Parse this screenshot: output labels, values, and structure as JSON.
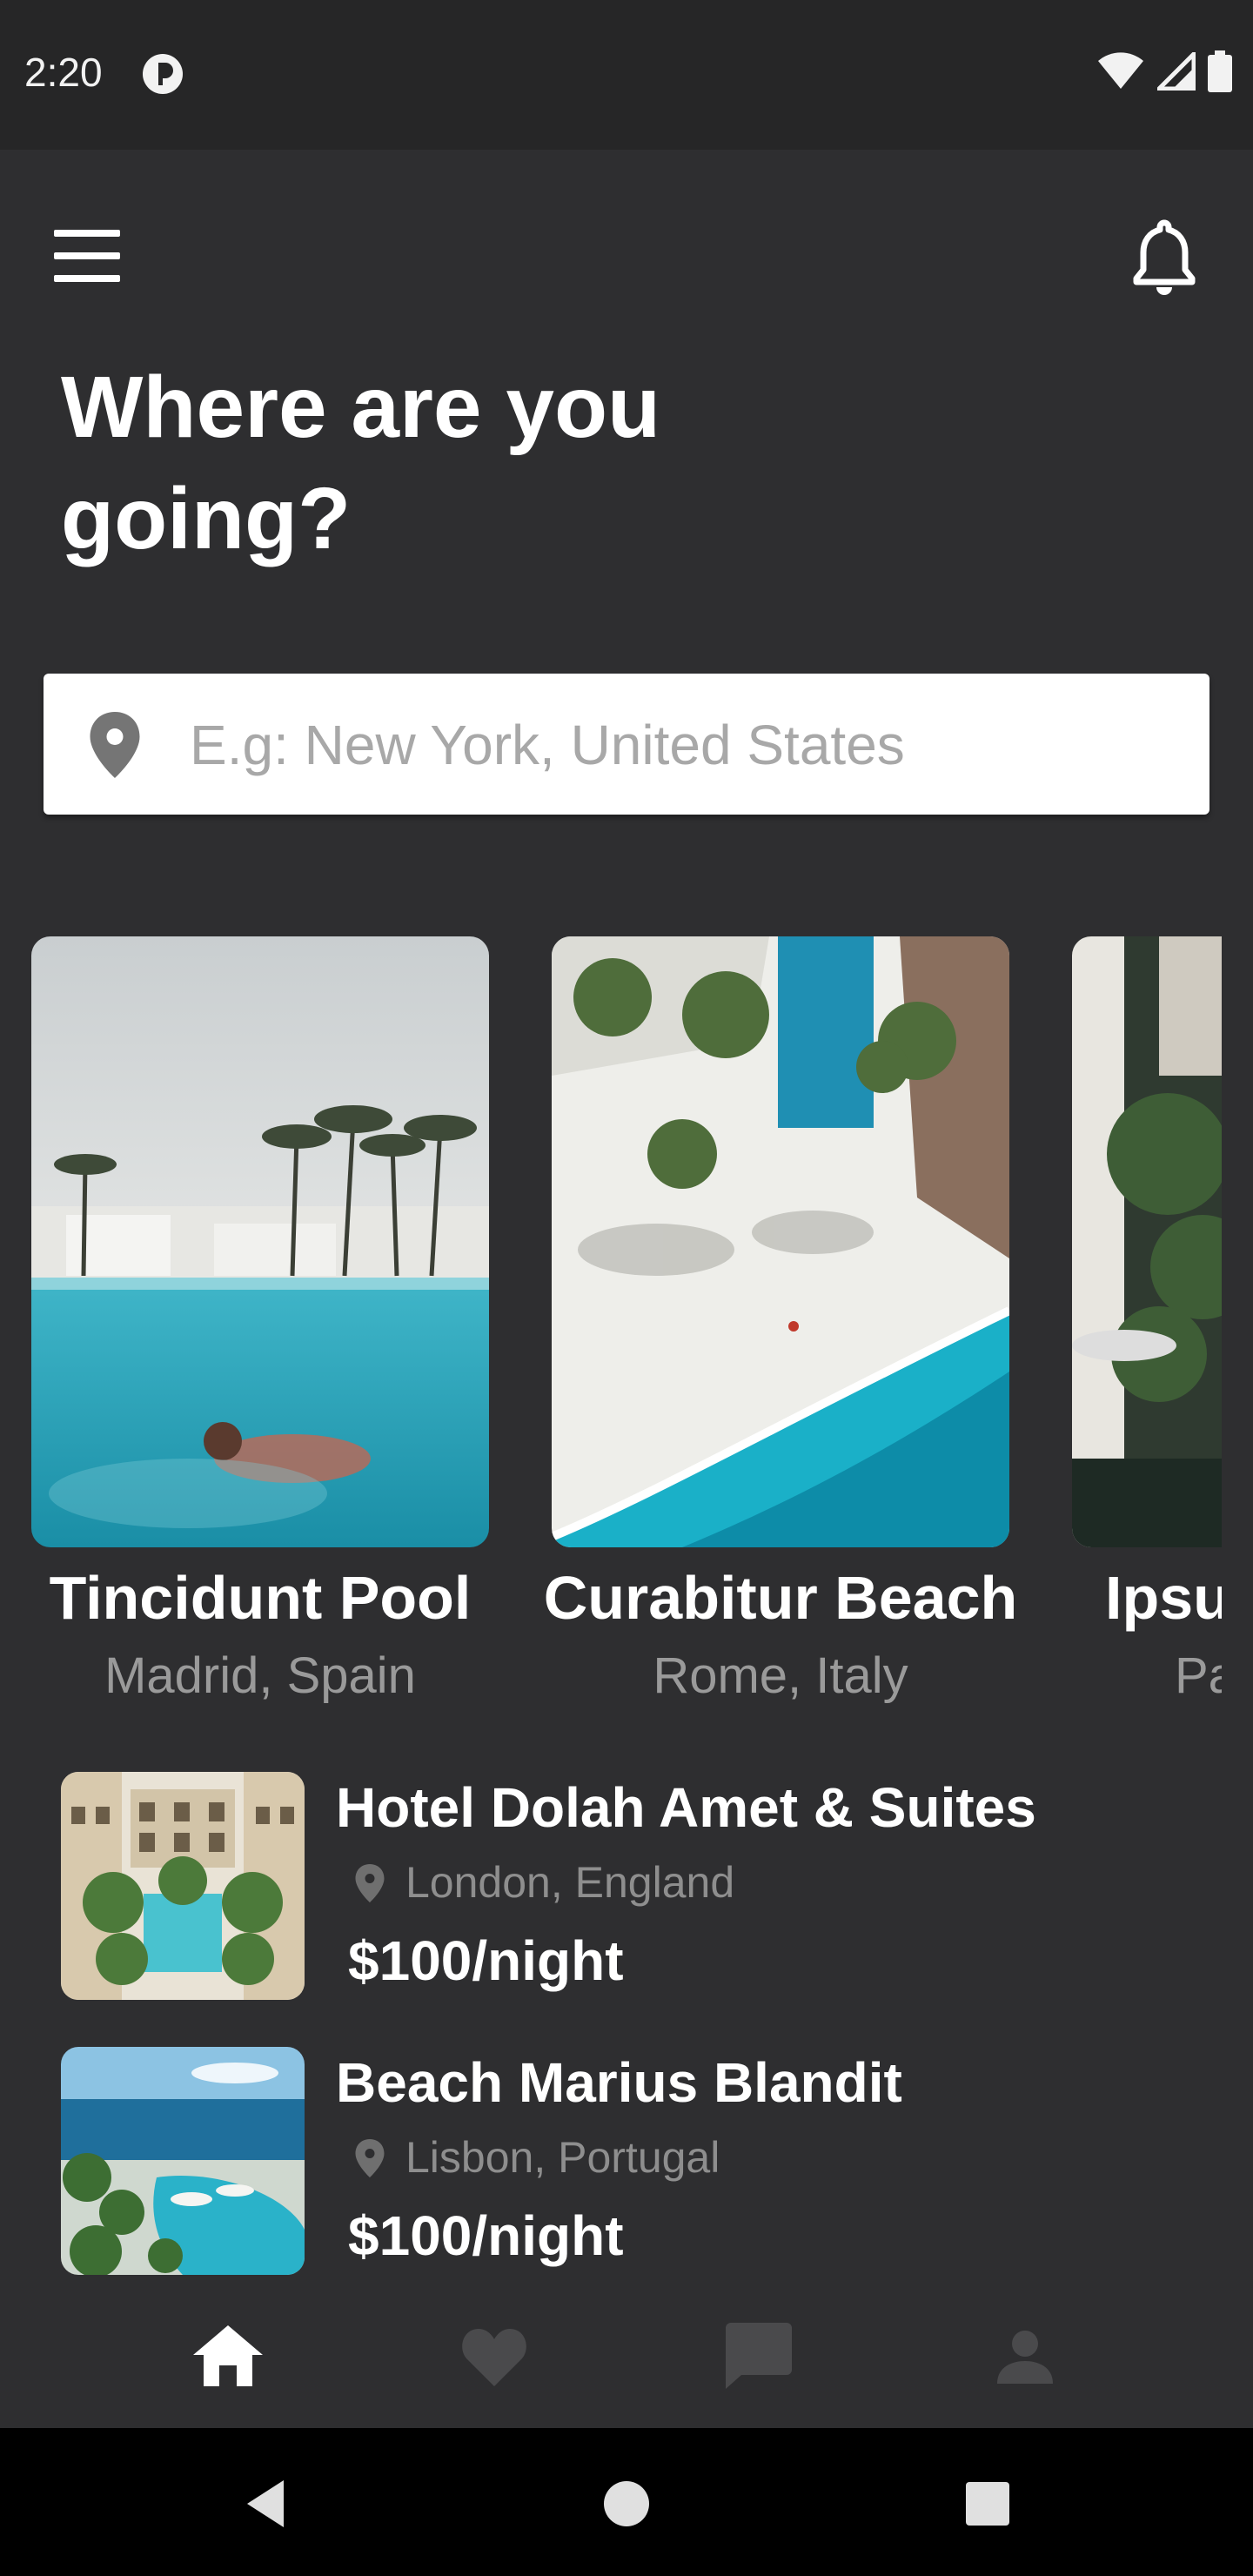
{
  "status_bar": {
    "time": "2:20"
  },
  "header": {
    "title": "Where are you\ngoing?"
  },
  "search": {
    "placeholder": "E.g: New York, United States",
    "value": ""
  },
  "featured": [
    {
      "name": "Tincidunt Pool",
      "location": "Madrid, Spain"
    },
    {
      "name": "Curabitur Beach",
      "location": "Rome, Italy"
    },
    {
      "name": "Ipsu",
      "location": "Pa"
    }
  ],
  "listings": [
    {
      "name": "Hotel Dolah Amet & Suites",
      "location": "London, England",
      "price": "$100/night"
    },
    {
      "name": "Beach Marius Blandit",
      "location": "Lisbon, Portugal",
      "price": "$100/night"
    }
  ],
  "bottom_nav": [
    {
      "icon": "home-icon",
      "active": true
    },
    {
      "icon": "heart-icon",
      "active": false
    },
    {
      "icon": "chat-icon",
      "active": false
    },
    {
      "icon": "profile-icon",
      "active": false
    }
  ],
  "colors": {
    "background": "#2e2e30",
    "status_bar": "#262627",
    "text_primary": "#ffffff",
    "text_secondary": "#9a9a9a",
    "nav_inactive": "#4a4a4c"
  }
}
